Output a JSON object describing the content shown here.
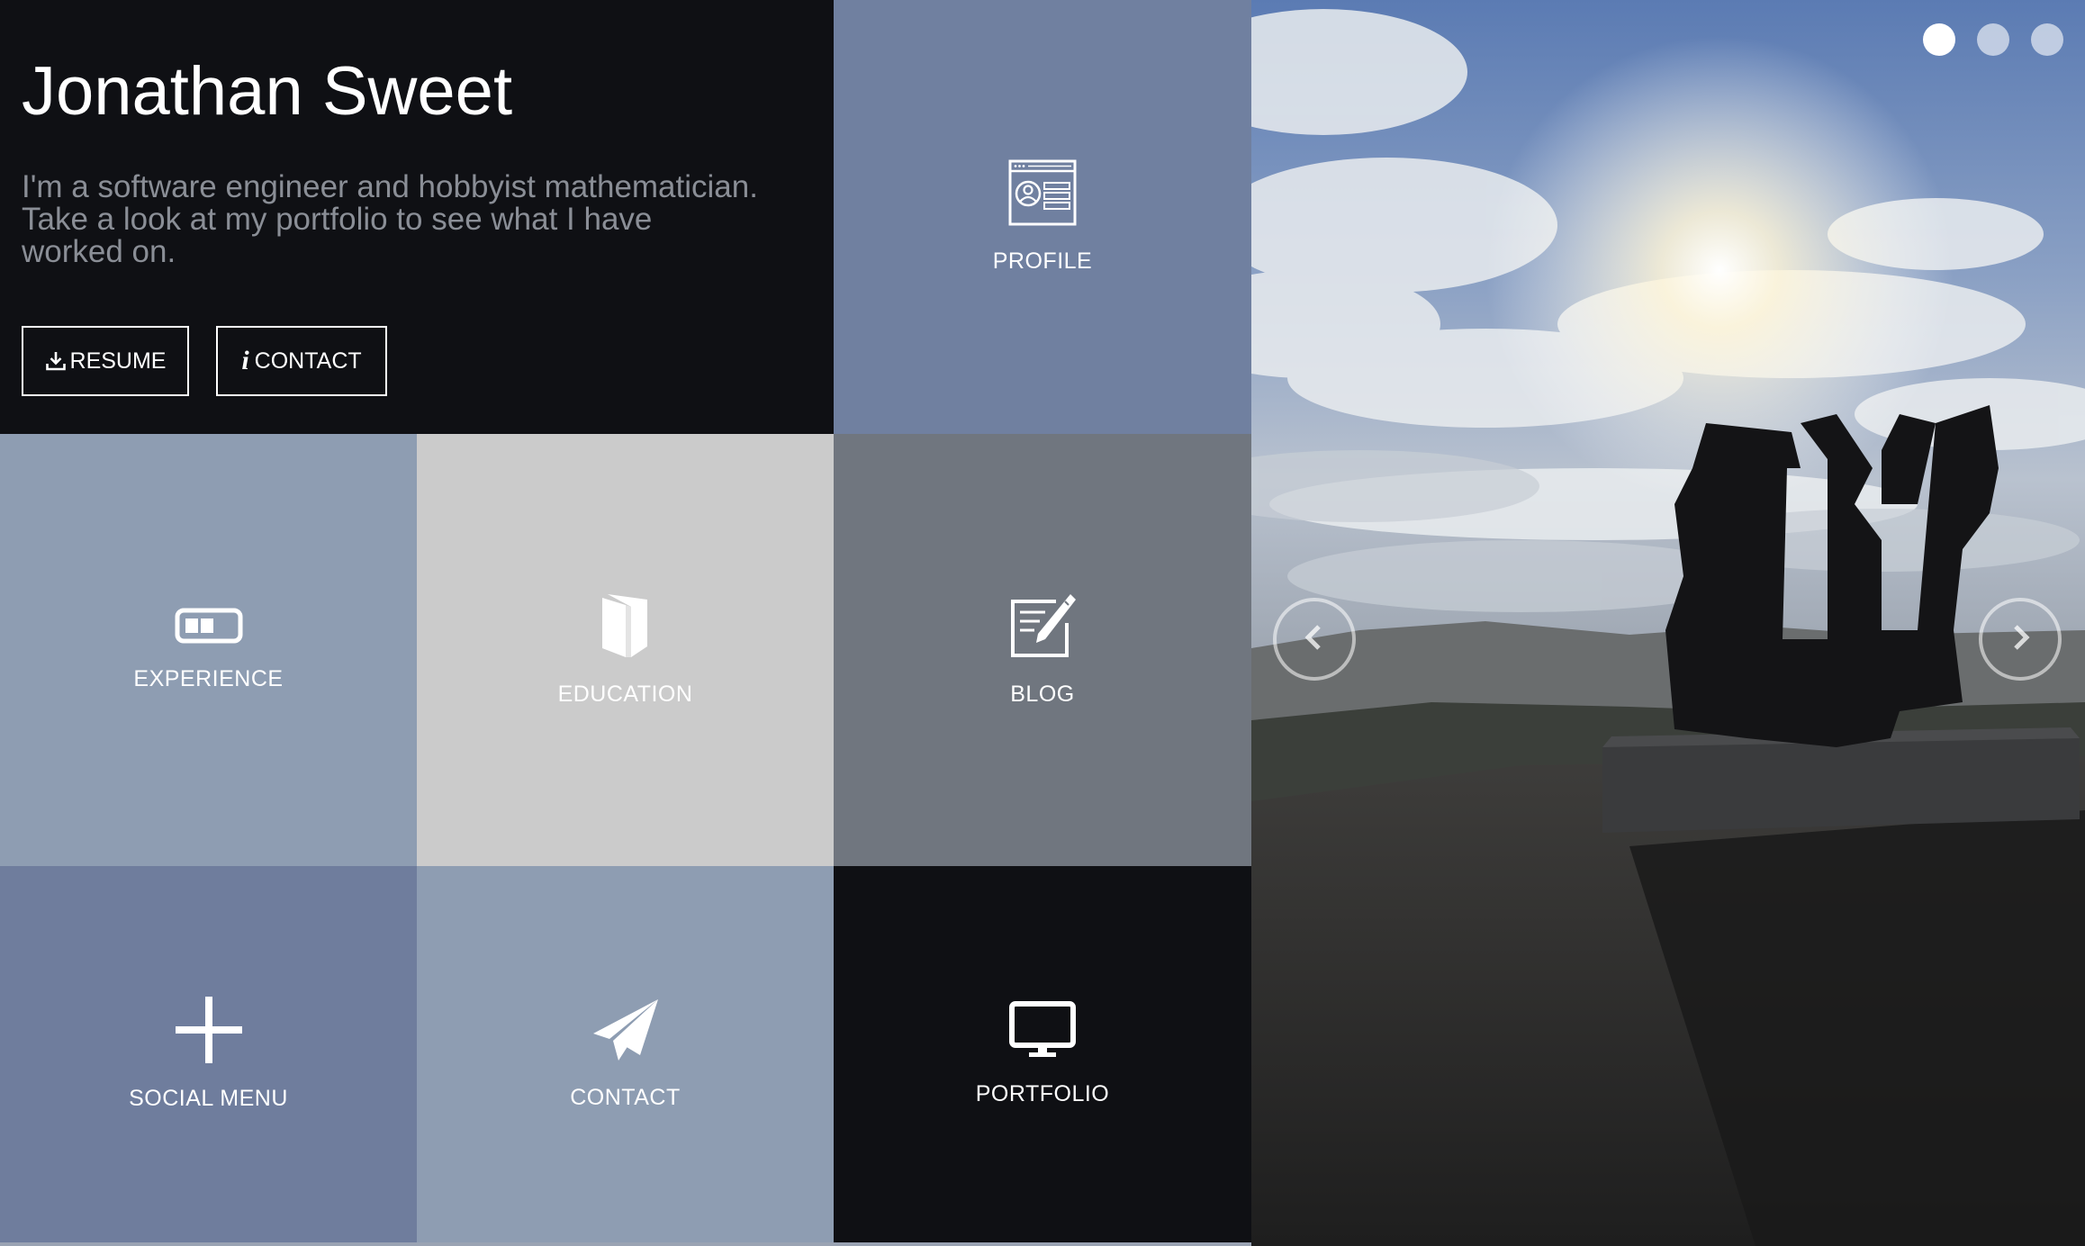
{
  "intro": {
    "name": "Jonathan Sweet",
    "bio_line1": "I'm a software engineer and hobbyist mathematician.",
    "bio_line2": "Take a look at my portfolio to see what I have worked on.",
    "resume_label": "RESUME",
    "contact_label": "CONTACT",
    "resume_icon": "download-icon",
    "contact_icon": "info-icon",
    "info_glyph": "i"
  },
  "tiles": {
    "profile": {
      "label": "PROFILE",
      "icon": "profile-card-icon",
      "color": "#7080a0"
    },
    "experience": {
      "label": "EXPERIENCE",
      "icon": "progress-bar-icon",
      "color": "#8e9db2"
    },
    "education": {
      "label": "EDUCATION",
      "icon": "book-icon",
      "color": "#cbcbcb"
    },
    "blog": {
      "label": "BLOG",
      "icon": "edit-document-icon",
      "color": "#70767f"
    },
    "social_menu": {
      "label": "SOCIAL MENU",
      "icon": "plus-icon",
      "color": "#6f7d9d"
    },
    "contact": {
      "label": "CONTACT",
      "icon": "paper-plane-icon",
      "color": "#8e9db2"
    },
    "portfolio": {
      "label": "PORTFOLIO",
      "icon": "monitor-icon",
      "color": "#0f1014"
    }
  },
  "slideshow": {
    "slide_count": 3,
    "active_slide": 1,
    "prev_icon": "chevron-left-icon",
    "next_icon": "chevron-right-icon",
    "photo_subject": "AHAVA sculpture against a cloudy sky"
  }
}
